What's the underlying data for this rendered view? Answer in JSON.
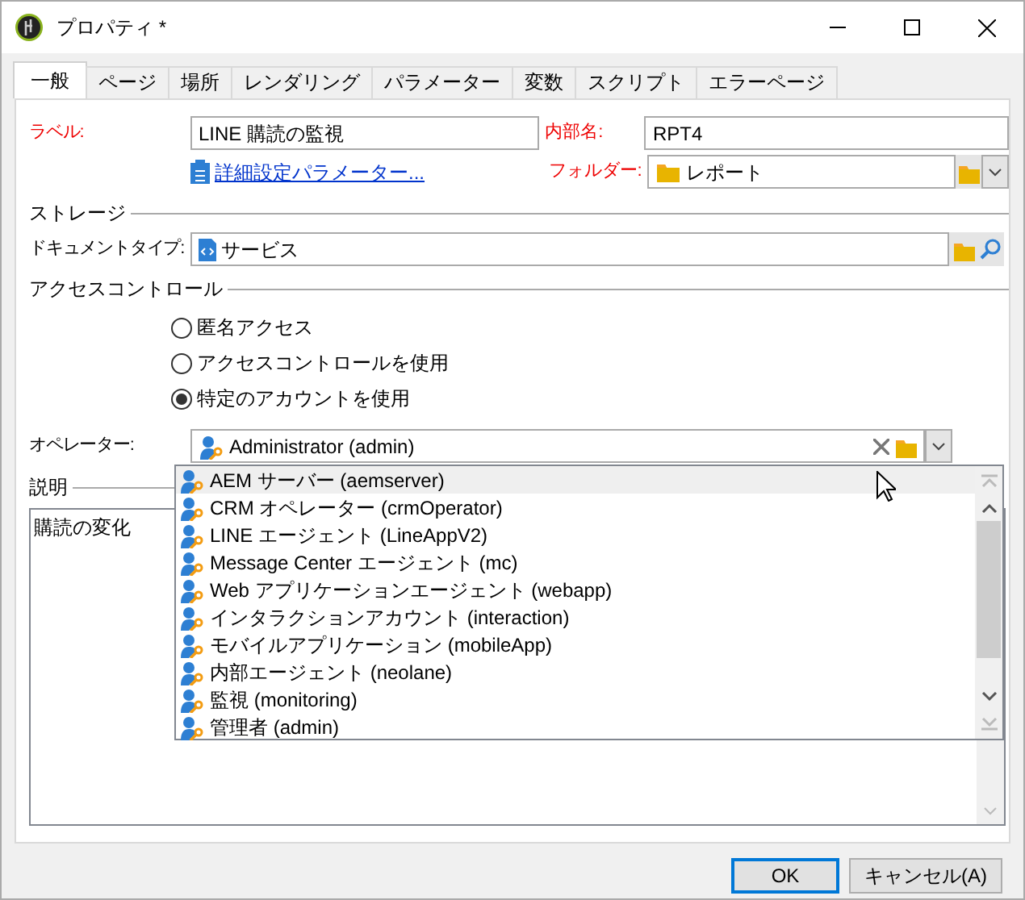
{
  "window": {
    "title": "プロパティ *"
  },
  "tabs": [
    {
      "label": "一般",
      "selected": true
    },
    {
      "label": "ページ",
      "selected": false
    },
    {
      "label": "場所",
      "selected": false
    },
    {
      "label": "レンダリング",
      "selected": false
    },
    {
      "label": "パラメーター",
      "selected": false
    },
    {
      "label": "変数",
      "selected": false
    },
    {
      "label": "スクリプト",
      "selected": false
    },
    {
      "label": "エラーページ",
      "selected": false
    }
  ],
  "general": {
    "label": {
      "caption": "ラベル:",
      "value": "LINE 購読の監視"
    },
    "internal_name": {
      "caption": "内部名:",
      "value": "RPT4"
    },
    "advanced_link": "詳細設定パラメーター...",
    "folder": {
      "caption": "フォルダー:",
      "value": "レポート"
    }
  },
  "storage": {
    "heading": "ストレージ",
    "document_type": {
      "caption": "ドキュメントタイプ:",
      "value": "サービス"
    }
  },
  "access_control": {
    "heading": "アクセスコントロール",
    "options": [
      {
        "label": "匿名アクセス",
        "selected": false
      },
      {
        "label": "アクセスコントロールを使用",
        "selected": false
      },
      {
        "label": "特定のアカウントを使用",
        "selected": true
      }
    ]
  },
  "operator": {
    "caption": "オペレーター:",
    "value": "Administrator (admin)",
    "dropdown": {
      "items": [
        {
          "label": "AEM サーバー (aemserver)",
          "selected": true
        },
        {
          "label": "CRM オペレーター (crmOperator)",
          "selected": false
        },
        {
          "label": "LINE エージェント (LineAppV2)",
          "selected": false
        },
        {
          "label": "Message Center エージェント (mc)",
          "selected": false
        },
        {
          "label": "Web アプリケーションエージェント (webapp)",
          "selected": false
        },
        {
          "label": "インタラクションアカウント (interaction)",
          "selected": false
        },
        {
          "label": "モバイルアプリケーション (mobileApp)",
          "selected": false
        },
        {
          "label": "内部エージェント (neolane)",
          "selected": false
        },
        {
          "label": "監視 (monitoring)",
          "selected": false
        },
        {
          "label": "管理者 (admin)",
          "selected": false
        }
      ]
    }
  },
  "description": {
    "heading": "説明",
    "value": "購読の変化"
  },
  "buttons": [
    {
      "label": "OK",
      "default": true
    },
    {
      "label": "キャンセル(A)",
      "default": false
    }
  ]
}
